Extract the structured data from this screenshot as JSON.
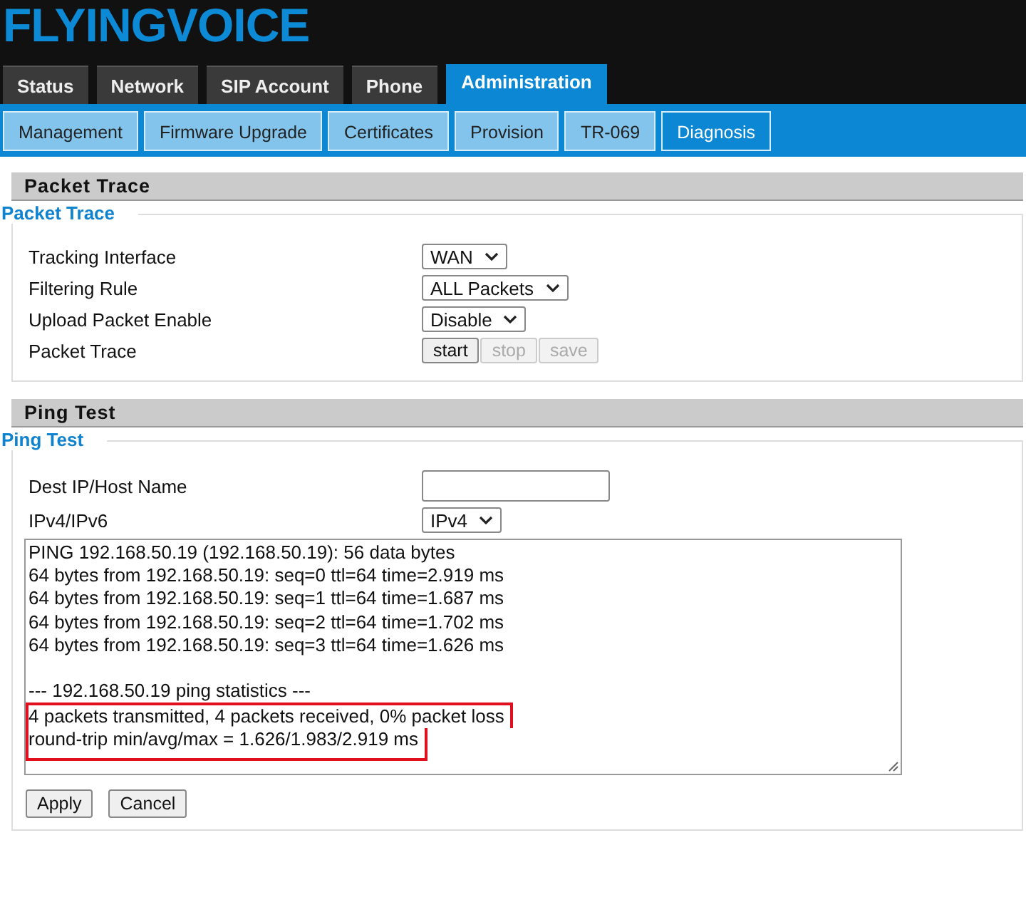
{
  "logo": "FLYINGVOICE",
  "tabs": [
    {
      "label": "Status",
      "selected": false
    },
    {
      "label": "Network",
      "selected": false
    },
    {
      "label": "SIP Account",
      "selected": false
    },
    {
      "label": "Phone",
      "selected": false
    },
    {
      "label": "Administration",
      "selected": true
    }
  ],
  "subtabs": [
    {
      "label": "Management",
      "selected": false
    },
    {
      "label": "Firmware Upgrade",
      "selected": false
    },
    {
      "label": "Certificates",
      "selected": false
    },
    {
      "label": "Provision",
      "selected": false
    },
    {
      "label": "TR-069",
      "selected": false
    },
    {
      "label": "Diagnosis",
      "selected": true
    }
  ],
  "packet_trace": {
    "header": "Packet Trace",
    "legend": "Packet Trace",
    "rows": [
      {
        "kind": "select",
        "label": "Tracking Interface",
        "value": "WAN"
      },
      {
        "kind": "select",
        "label": "Filtering Rule",
        "value": "ALL Packets"
      },
      {
        "kind": "select",
        "label": "Upload Packet Enable",
        "value": "Disable"
      },
      {
        "kind": "buttons",
        "label": "Packet Trace",
        "buttons": [
          {
            "label": "start",
            "disabled": false
          },
          {
            "label": "stop",
            "disabled": true
          },
          {
            "label": "save",
            "disabled": true
          }
        ]
      }
    ]
  },
  "ping_test": {
    "header": "Ping Test",
    "legend": "Ping Test",
    "rows": [
      {
        "kind": "input",
        "label": "Dest IP/Host Name"
      },
      {
        "kind": "select",
        "label": "IPv4/IPv6",
        "value": "IPv4"
      }
    ],
    "output": {
      "paragraphs": [
        {
          "lines": [
            {
              "text": "PING 192.168.50.19 (192.168.50.19): 56 data bytes",
              "highlighted": false
            },
            {
              "text": "64 bytes from 192.168.50.19: seq=0 ttl=64 time=2.919 ms",
              "highlighted": false
            },
            {
              "text": "64 bytes from 192.168.50.19: seq=1 ttl=64 time=1.687 ms",
              "highlighted": false
            },
            {
              "text": "64 bytes from 192.168.50.19: seq=2 ttl=64 time=1.702 ms",
              "highlighted": false
            },
            {
              "text": "64 bytes from 192.168.50.19: seq=3 ttl=64 time=1.626 ms",
              "highlighted": false
            }
          ]
        },
        {
          "lines": [
            {
              "text": "--- 192.168.50.19 ping statistics ---",
              "highlighted": false
            },
            {
              "text": "4 packets transmitted, 4 packets received, 0% packet loss",
              "highlighted": true
            },
            {
              "text": "round-trip min/avg/max = 1.626/1.983/2.919 ms",
              "highlighted": true
            }
          ]
        }
      ]
    },
    "buttons": [
      {
        "label": "Apply",
        "disabled": false
      },
      {
        "label": "Cancel",
        "disabled": false
      }
    ]
  }
}
